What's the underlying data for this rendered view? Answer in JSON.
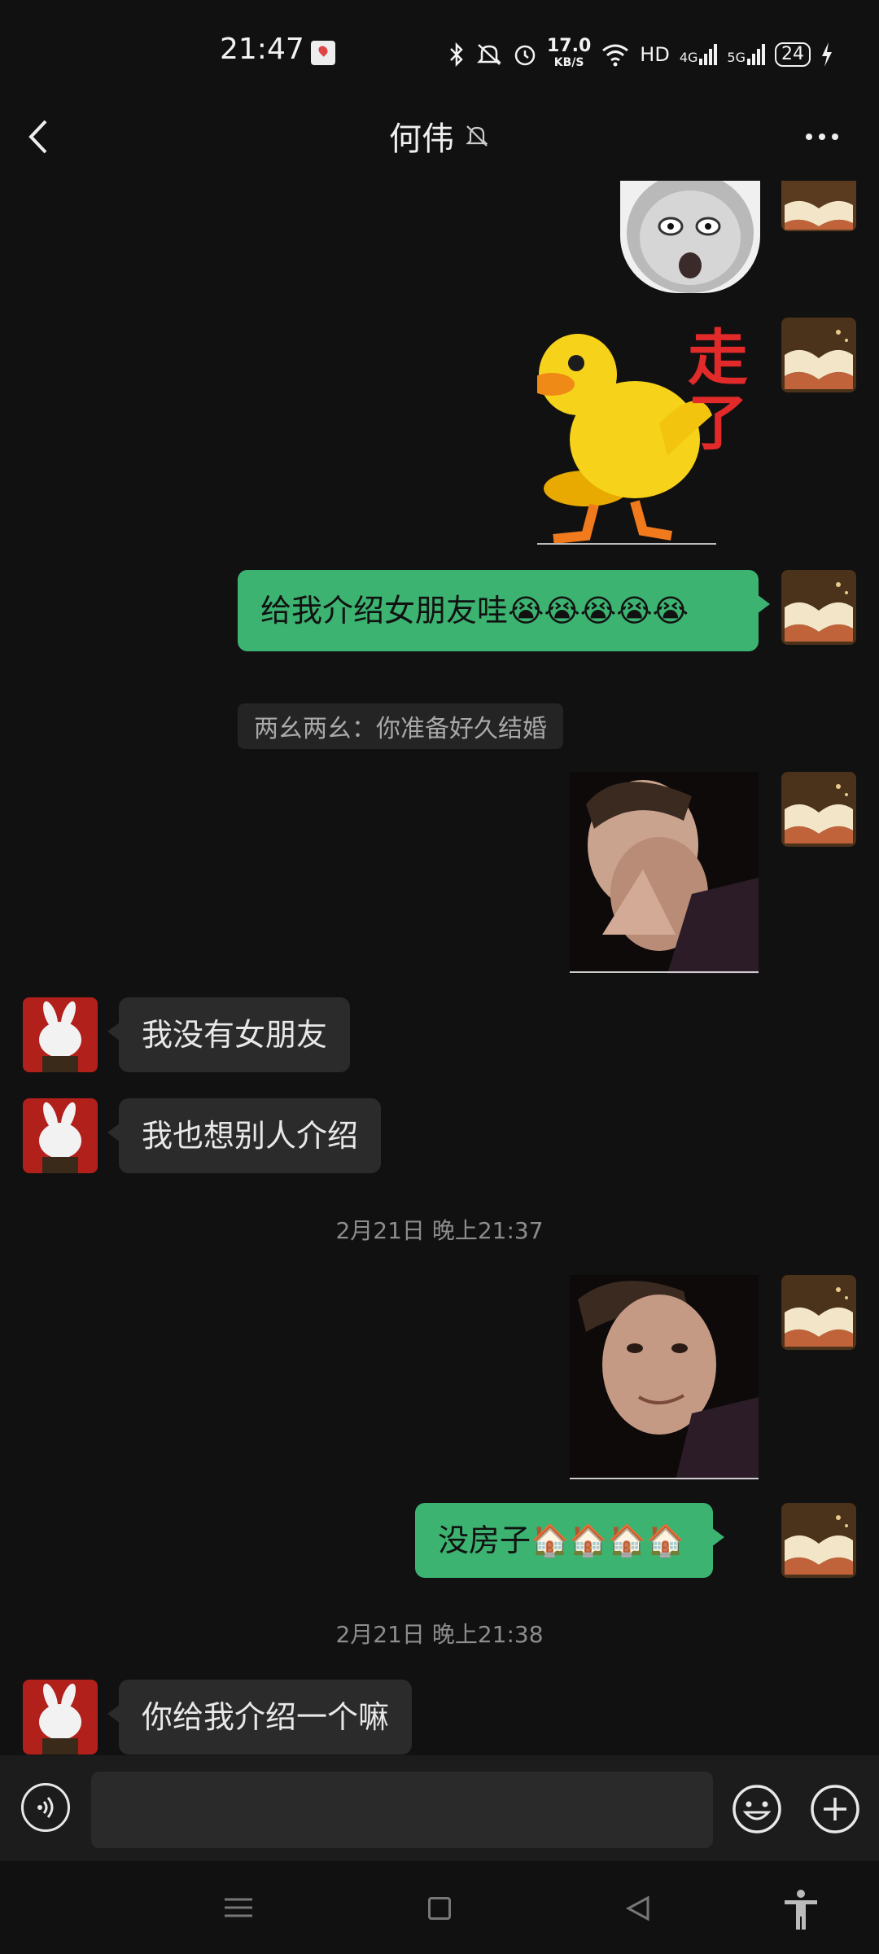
{
  "status_bar": {
    "time": "21:47",
    "network_speed": "17.0",
    "speed_unit": "KB/S",
    "hd_label": "HD",
    "signal_4g": "4G",
    "signal_5g": "5G",
    "battery": "24",
    "icons": [
      "map-pin-icon",
      "bluetooth-icon",
      "mute-icon",
      "alarm-icon",
      "wifi-icon",
      "signal-icon",
      "charging-icon"
    ]
  },
  "header": {
    "back_icon": "chevron-left-icon",
    "title": "何伟",
    "mute_icon": "bell-off-icon",
    "more_icon": "more-dots-icon"
  },
  "messages": [
    {
      "side": "me",
      "type": "sticker",
      "desc": "surprised-face-sticker"
    },
    {
      "side": "me",
      "type": "sticker",
      "desc": "duck-leaving-sticker",
      "text": "走了"
    },
    {
      "side": "me",
      "type": "text",
      "text": "给我介绍女朋友哇😭😭😭😭😭",
      "quote": "两幺两幺：你准备好久结婚"
    },
    {
      "side": "me",
      "type": "photo",
      "desc": "man-crying-photo"
    },
    {
      "side": "other",
      "type": "text",
      "text": "我没有女朋友"
    },
    {
      "side": "other",
      "type": "text",
      "text": "我也想别人介绍"
    },
    {
      "type": "timestamp",
      "text": "2月21日 晚上21:37"
    },
    {
      "side": "me",
      "type": "photo",
      "desc": "man-smiling-photo"
    },
    {
      "side": "me",
      "type": "text",
      "text": "没房子🏠🏠🏠🏠"
    },
    {
      "type": "timestamp",
      "text": "2月21日 晚上21:38"
    },
    {
      "side": "other",
      "type": "text",
      "text": "你给我介绍一个嘛"
    }
  ],
  "input_bar": {
    "voice_icon": "voice-icon",
    "input_value": "",
    "emoji_icon": "emoji-icon",
    "plus_icon": "plus-icon"
  },
  "nav": {
    "icons": [
      "menu-icon",
      "home-icon",
      "back-triangle-icon",
      "accessibility-icon"
    ]
  },
  "colors": {
    "background": "#111111",
    "my_bubble": "#3cb371",
    "other_bubble": "#2b2b2b"
  }
}
